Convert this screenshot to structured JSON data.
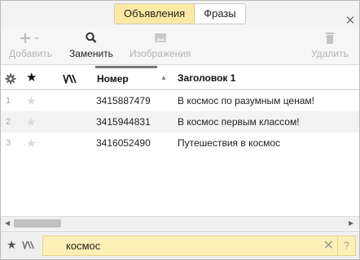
{
  "tabs": [
    {
      "label": "Объявления",
      "active": true
    },
    {
      "label": "Фразы",
      "active": false
    }
  ],
  "toolbar": {
    "add": {
      "label": "Добавить",
      "icon": "plus-icon",
      "enabled": false
    },
    "replace": {
      "label": "Заменить",
      "icon": "search-icon",
      "enabled": true
    },
    "images": {
      "label": "Изображения",
      "icon": "image-icon",
      "enabled": false
    },
    "delete": {
      "label": "Удалить",
      "icon": "trash-icon",
      "enabled": false
    }
  },
  "table": {
    "columns": {
      "settings_icon": "gear-icon",
      "star_icon": "star-icon",
      "flag_icon": "flag-icon",
      "number": "Номер",
      "title": "Заголовок 1"
    },
    "rows": [
      {
        "index": "1",
        "number": "3415887479",
        "title": "В космос по разумным ценам!"
      },
      {
        "index": "2",
        "number": "3415944831",
        "title": "В космос первым классом!"
      },
      {
        "index": "3",
        "number": "3416052490",
        "title": "Путешествия в космос"
      }
    ]
  },
  "search": {
    "value": "космос"
  },
  "colors": {
    "active_tab": "#fde9a4",
    "search_bg": "#fdf0b6"
  }
}
